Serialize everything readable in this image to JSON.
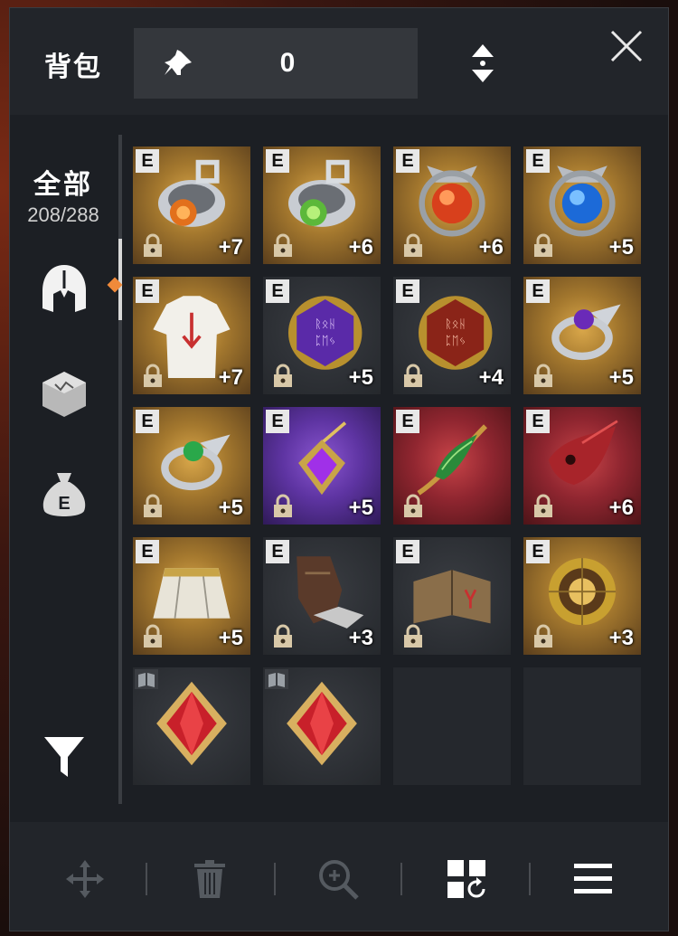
{
  "header": {
    "title": "背包",
    "pin_count": "0"
  },
  "sidebar": {
    "category_label": "全部",
    "capacity": "208/288"
  },
  "grid": {
    "slots": [
      {
        "badge": "E",
        "level": "+7",
        "bg": "gold",
        "item": "silver-ring-orange-gem"
      },
      {
        "badge": "E",
        "level": "+6",
        "bg": "gold",
        "item": "silver-ring-green-gem"
      },
      {
        "badge": "E",
        "level": "+6",
        "bg": "gold",
        "item": "winged-amulet-red-orb"
      },
      {
        "badge": "E",
        "level": "+5",
        "bg": "gold",
        "item": "winged-amulet-blue-orb"
      },
      {
        "badge": "E",
        "level": "+7",
        "bg": "gold",
        "item": "white-robe-armor"
      },
      {
        "badge": "E",
        "level": "+5",
        "bg": "gray",
        "item": "purple-rune-shield"
      },
      {
        "badge": "E",
        "level": "+4",
        "bg": "gray",
        "item": "red-rune-shield"
      },
      {
        "badge": "E",
        "level": "+5",
        "bg": "gold",
        "item": "winged-ring-purple-gem"
      },
      {
        "badge": "E",
        "level": "+5",
        "bg": "gold",
        "item": "winged-ring-green-gem"
      },
      {
        "badge": "E",
        "level": "+5",
        "bg": "purple",
        "item": "purple-gem-pendant"
      },
      {
        "badge": "E",
        "level": "",
        "bg": "red",
        "item": "green-leaf-bow"
      },
      {
        "badge": "E",
        "level": "+6",
        "bg": "red",
        "item": "red-feather-mask"
      },
      {
        "badge": "E",
        "level": "+5",
        "bg": "gold",
        "item": "plated-skirt"
      },
      {
        "badge": "E",
        "level": "+3",
        "bg": "gray",
        "item": "leather-gauntlet"
      },
      {
        "badge": "E",
        "level": "",
        "bg": "gray",
        "item": "rune-tome"
      },
      {
        "badge": "E",
        "level": "+3",
        "bg": "gold",
        "item": "golden-orb-talisman"
      },
      {
        "badge": "book",
        "level": "",
        "bg": "gray",
        "item": "red-diamond-crystal"
      },
      {
        "badge": "book",
        "level": "",
        "bg": "gray",
        "item": "red-diamond-crystal"
      },
      {
        "badge": "",
        "level": "",
        "bg": "empty",
        "item": ""
      },
      {
        "badge": "",
        "level": "",
        "bg": "empty",
        "item": ""
      }
    ]
  },
  "colors": {
    "panel": "#1c1f24",
    "accent": "#f08a3a",
    "gold_slot": "#a4782e",
    "purple_slot": "#5e34a2",
    "red_slot": "#902630"
  }
}
